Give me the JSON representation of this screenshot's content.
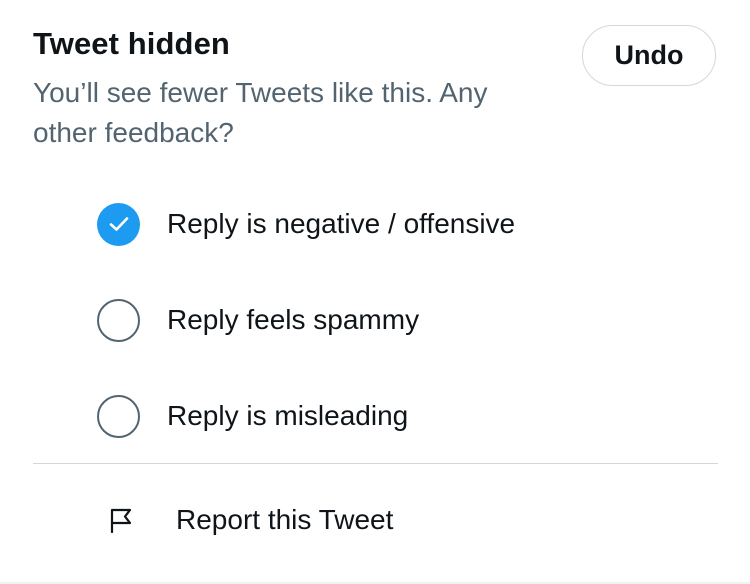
{
  "header": {
    "title": "Tweet hidden",
    "subtitle": "You’ll see fewer Tweets like this. Any other feedback?",
    "undo_label": "Undo"
  },
  "feedback_options": [
    {
      "label": "Reply is negative / offensive",
      "checked": true
    },
    {
      "label": "Reply feels spammy",
      "checked": false
    },
    {
      "label": "Reply is misleading",
      "checked": false
    }
  ],
  "report": {
    "label": "Report this Tweet",
    "icon": "flag-icon"
  },
  "colors": {
    "accent": "#1d9bf0",
    "text_primary": "#0f1419",
    "text_secondary": "#536471",
    "border": "#cfd9de"
  }
}
